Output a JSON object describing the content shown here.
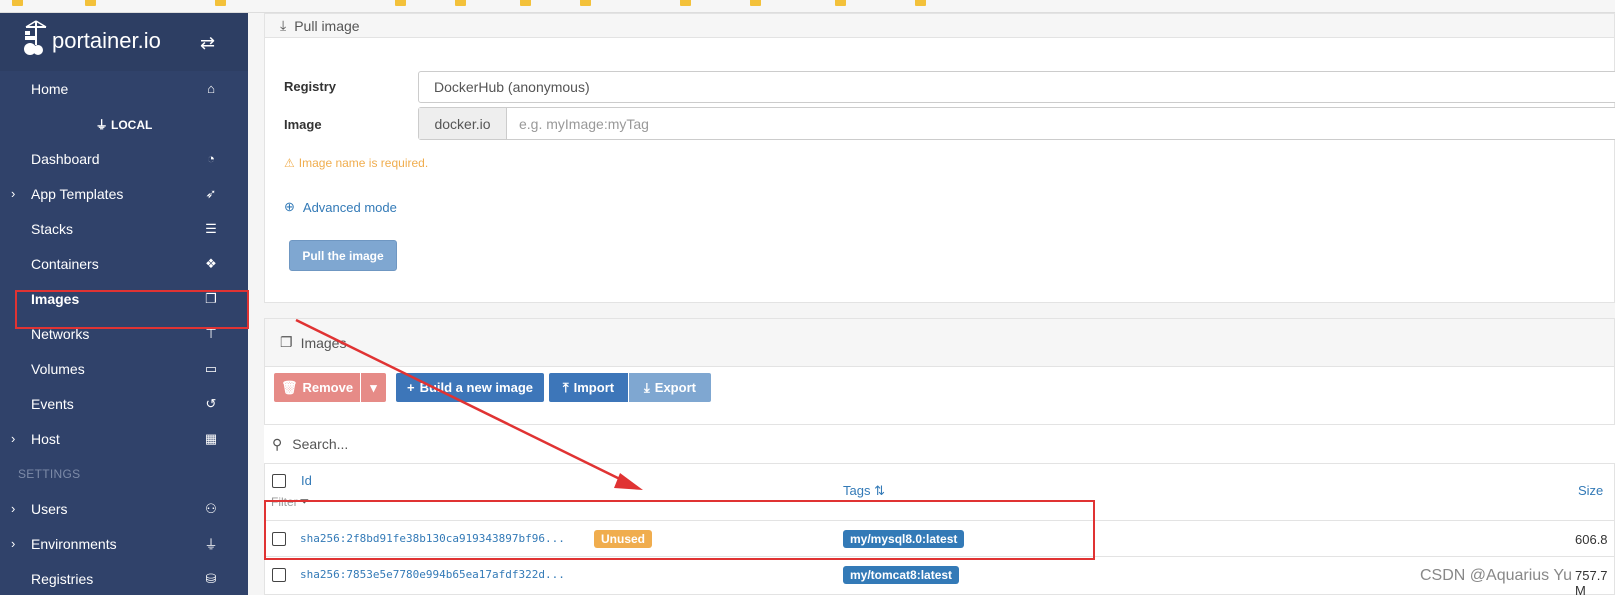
{
  "sidebar": {
    "brand": "portainer.io",
    "endpoint": "LOCAL",
    "items": [
      {
        "label": "Home",
        "icon": "home-icon"
      },
      {
        "label": "Dashboard",
        "icon": "tachometer-icon"
      },
      {
        "label": "App Templates",
        "icon": "rocket-icon"
      },
      {
        "label": "Stacks",
        "icon": "th-list-icon"
      },
      {
        "label": "Containers",
        "icon": "cubes-icon"
      },
      {
        "label": "Images",
        "icon": "clone-icon"
      },
      {
        "label": "Networks",
        "icon": "sitemap-icon"
      },
      {
        "label": "Volumes",
        "icon": "hdd-icon"
      },
      {
        "label": "Events",
        "icon": "history-icon"
      },
      {
        "label": "Host",
        "icon": "th-icon"
      }
    ],
    "settings_heading": "SETTINGS",
    "settings_items": [
      {
        "label": "Users",
        "icon": "users-icon"
      },
      {
        "label": "Environments",
        "icon": "plug-icon"
      },
      {
        "label": "Registries",
        "icon": "database-icon"
      }
    ]
  },
  "pull": {
    "title": "Pull image",
    "registry_label": "Registry",
    "registry_value": "DockerHub (anonymous)",
    "image_label": "Image",
    "image_prefix": "docker.io",
    "image_placeholder": "e.g. myImage:myTag",
    "warning": "Image name is required.",
    "advanced_mode": "Advanced mode",
    "pull_button": "Pull the image"
  },
  "images": {
    "title": "Images",
    "remove": "Remove",
    "build": "Build a new image",
    "import": "Import",
    "export": "Export",
    "search_placeholder": "Search...",
    "col_id": "Id",
    "col_tags": "Tags",
    "col_size": "Size",
    "filter": "Filter",
    "rows": [
      {
        "id": "sha256:2f8bd91fe38b130ca919343897bf96...",
        "badge": "Unused",
        "tag": "my/mysql8.0:latest",
        "size": "606.8"
      },
      {
        "id": "sha256:7853e5e7780e994b65ea17afdf322d...",
        "badge": "",
        "tag": "my/tomcat8:latest",
        "size": "757.7 M"
      }
    ]
  },
  "watermark": "CSDN @Aquarius Yu",
  "colors": {
    "sidebar": "#30426a",
    "primary": "#337ab7",
    "danger": "#e68b87",
    "warning": "#f0ad4e",
    "annotation": "#e03333"
  }
}
